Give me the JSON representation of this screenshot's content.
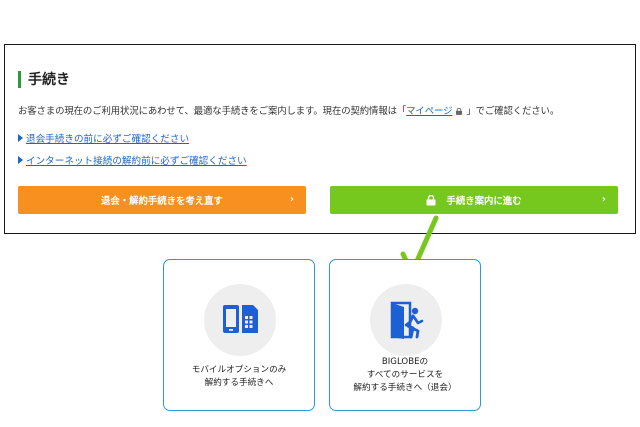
{
  "procedure": {
    "title": "手続き",
    "description_pre": "お客さまの現在のご利用状況にあわせて、最適な手続きをご案内します。現在の契約情報は「",
    "description_link": "マイページ",
    "description_post": "」でご確認ください。",
    "links": [
      {
        "label": "退会手続きの前に必ずご確認ください"
      },
      {
        "label": "インターネット接続の解約前に必ずご確認ください"
      }
    ],
    "buttons": {
      "reconsider_label": "退会・解約手続きを考え直す",
      "proceed_label": "手続き案内に進む",
      "chevron": "›"
    }
  },
  "cards": [
    {
      "line1": "モバイルオプションのみ",
      "line2": "解約する手続きへ",
      "icon": "mobile-sim-icon"
    },
    {
      "line1": "BIGLOBEの",
      "line2": "すべてのサービスを",
      "line3": "解約する手続きへ（退会）",
      "icon": "exit-door-icon"
    }
  ],
  "colors": {
    "accent_green": "#77c81e",
    "accent_orange": "#f7901e",
    "link_blue": "#1a66c9",
    "card_border": "#2c9ad4",
    "icon_blue": "#1d5fd4"
  }
}
